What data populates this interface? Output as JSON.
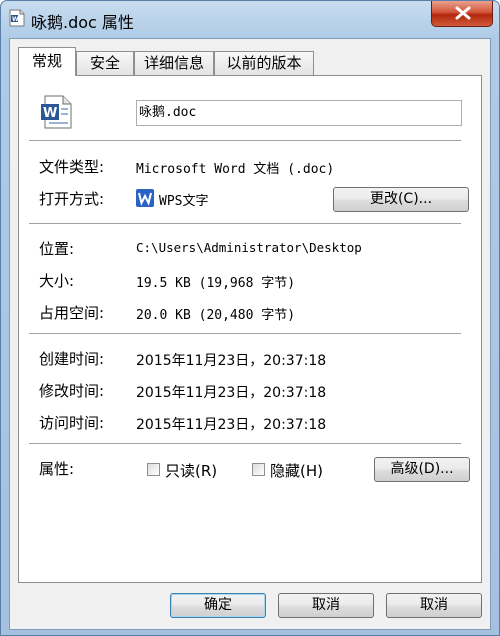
{
  "window": {
    "title": "咏鹅.doc 属性"
  },
  "tabs": [
    {
      "label": "常规",
      "active": true
    },
    {
      "label": "安全",
      "active": false
    },
    {
      "label": "详细信息",
      "active": false
    },
    {
      "label": "以前的版本",
      "active": false
    }
  ],
  "general": {
    "file_name": "咏鹅.doc",
    "type_label": "文件类型:",
    "type_value": "Microsoft Word 文档 (.doc)",
    "opens_with_label": "打开方式:",
    "opens_with_value": "WPS文字",
    "change_button": "更改(C)...",
    "location_label": "位置:",
    "location_value": "C:\\Users\\Administrator\\Desktop",
    "size_label": "大小:",
    "size_value": "19.5 KB (19,968 字节)",
    "size_on_disk_label": "占用空间:",
    "size_on_disk_value": "20.0 KB (20,480 字节)",
    "created_label": "创建时间:",
    "created_value": "2015年11月23日，20:37:18",
    "modified_label": "修改时间:",
    "modified_value": "2015年11月23日，20:37:18",
    "accessed_label": "访问时间:",
    "accessed_value": "2015年11月23日，20:37:18",
    "attributes_label": "属性:",
    "readonly_label": "只读(R)",
    "hidden_label": "隐藏(H)",
    "advanced_button": "高级(D)..."
  },
  "footer": {
    "ok": "确定",
    "cancel": "取消",
    "apply": "取消"
  },
  "colors": {
    "word_icon_blue": "#2b5797",
    "wps_icon_blue": "#2a63c6",
    "close_red": "#c9462c"
  }
}
